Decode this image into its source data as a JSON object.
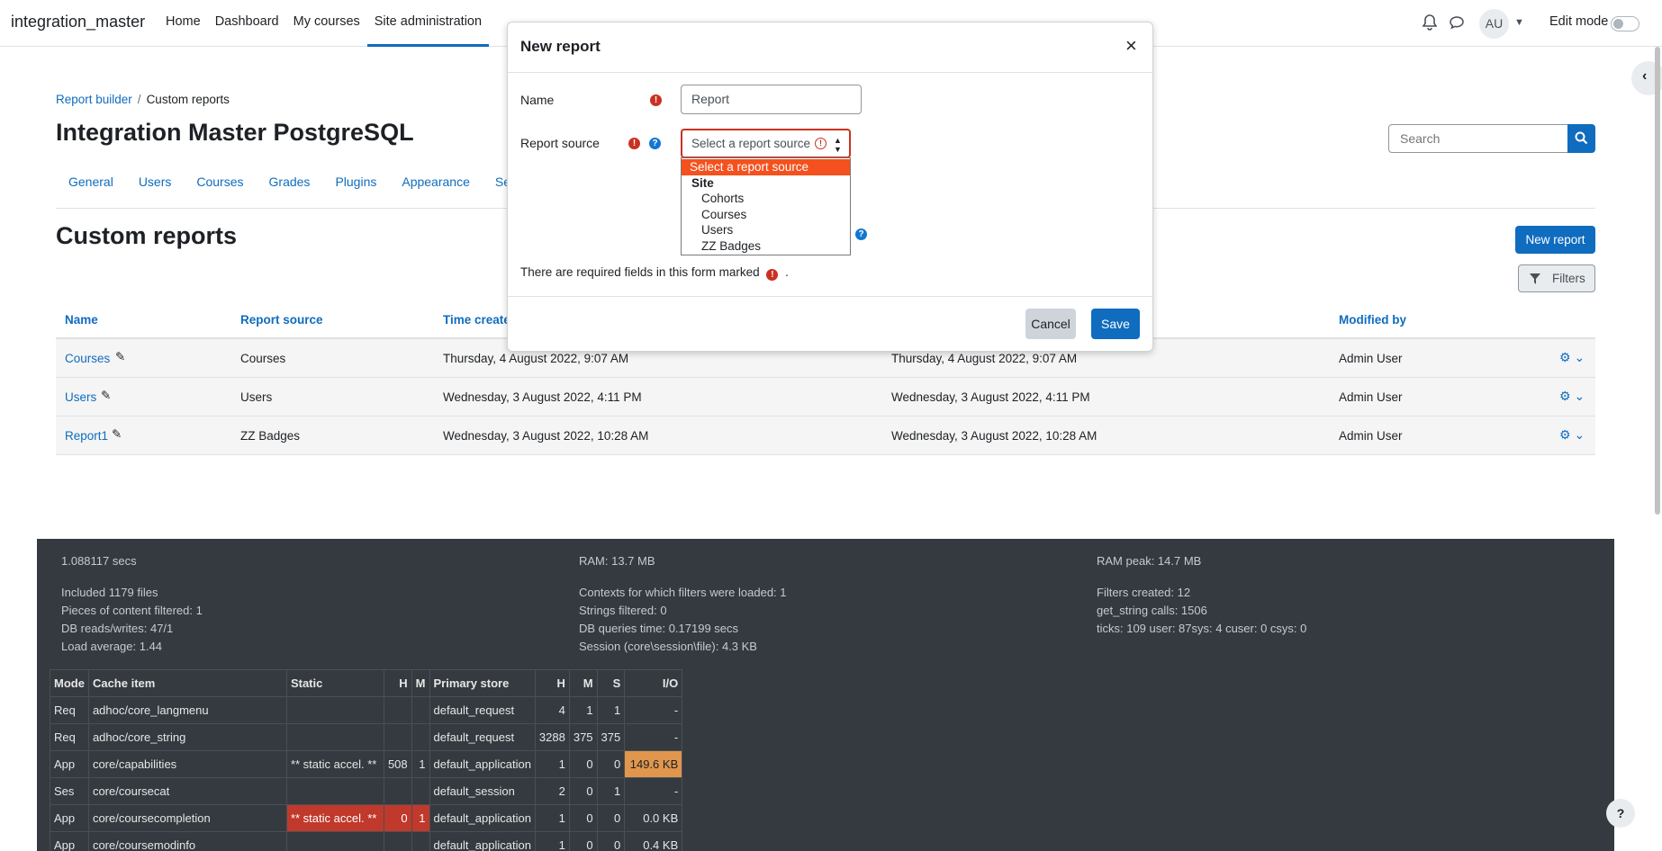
{
  "navbar": {
    "brand": "integration_master",
    "links": [
      "Home",
      "Dashboard",
      "My courses",
      "Site administration"
    ],
    "avatar": "AU",
    "edit_mode_label": "Edit mode"
  },
  "breadcrumb": {
    "items": [
      "Report builder",
      "Custom reports"
    ],
    "separator": "/"
  },
  "page_title": "Integration Master PostgreSQL",
  "search": {
    "placeholder": "Search"
  },
  "secnav": {
    "tabs": [
      "General",
      "Users",
      "Courses",
      "Grades",
      "Plugins",
      "Appearance",
      "Se"
    ]
  },
  "section": {
    "title": "Custom reports",
    "new_report_label": "New report",
    "filters_label": "Filters"
  },
  "table": {
    "headers": [
      "Name",
      "Report source",
      "Time create",
      "Modified by"
    ],
    "rows": [
      {
        "name": "Courses",
        "source": "Courses",
        "created": "Thursday, 4 August 2022, 9:07 AM",
        "modified": "Thursday, 4 August 2022, 9:07 AM",
        "by": "Admin User"
      },
      {
        "name": "Users",
        "source": "Users",
        "created": "Wednesday, 3 August 2022, 4:11 PM",
        "modified": "Wednesday, 3 August 2022, 4:11 PM",
        "by": "Admin User"
      },
      {
        "name": "Report1",
        "source": "ZZ Badges",
        "created": "Wednesday, 3 August 2022, 10:28 AM",
        "modified": "Wednesday, 3 August 2022, 10:28 AM",
        "by": "Admin User"
      }
    ]
  },
  "modal": {
    "title": "New report",
    "close": "×",
    "name_label": "Name",
    "name_value": "Report",
    "source_label": "Report source",
    "select_value": "Select a report source",
    "options": {
      "placeholder": "Select a report source",
      "group": "Site",
      "items": [
        "Cohorts",
        "Courses",
        "Users",
        "ZZ Badges"
      ]
    },
    "required_note": "There are required fields in this form marked",
    "required_note_end": ".",
    "cancel_label": "Cancel",
    "save_label": "Save"
  },
  "footer": {
    "col1": [
      "1.088117 secs",
      "Included 1179 files",
      "Pieces of content filtered: 1",
      "DB reads/writes: 47/1",
      "Load average: 1.44"
    ],
    "col2": [
      "RAM: 13.7 MB",
      "Contexts for which filters were loaded: 1",
      "Strings filtered: 0",
      "DB queries time: 0.17199 secs",
      "Session (core\\session\\file): 4.3 KB"
    ],
    "col3": [
      "RAM peak: 14.7 MB",
      "Filters created: 12",
      "get_string calls: 1506",
      "ticks: 109 user: 87sys: 4 cuser: 0 csys: 0"
    ],
    "cache_headers": [
      "Mode",
      "Cache item",
      "Static",
      "H",
      "M",
      "Primary store",
      "H",
      "M",
      "S",
      "I/O"
    ],
    "cache_rows": [
      [
        "Req",
        "adhoc/core_langmenu",
        "",
        "",
        "",
        "default_request",
        "4",
        "1",
        "1",
        "-"
      ],
      [
        "Req",
        "adhoc/core_string",
        "",
        "",
        "",
        "default_request",
        "3288",
        "375",
        "375",
        "-"
      ],
      [
        "App",
        "core/capabilities",
        "** static accel. **",
        "508",
        "1",
        "default_application",
        "1",
        "0",
        "0",
        "149.6 KB"
      ],
      [
        "Ses",
        "core/coursecat",
        "",
        "",
        "",
        "default_session",
        "2",
        "0",
        "1",
        "-"
      ],
      [
        "App",
        "core/coursecompletion",
        "** static accel. **",
        "0",
        "1",
        "default_application",
        "1",
        "0",
        "0",
        "0.0 KB"
      ],
      [
        "App",
        "core/coursemodinfo",
        "",
        "",
        "",
        "default_application",
        "1",
        "0",
        "0",
        "0.4 KB"
      ]
    ]
  },
  "help_button": "?",
  "colors": {
    "accent": "#0f6cbf",
    "required": "#ca3120",
    "selected_option": "#f4511e",
    "footer_bg": "#343a40"
  }
}
